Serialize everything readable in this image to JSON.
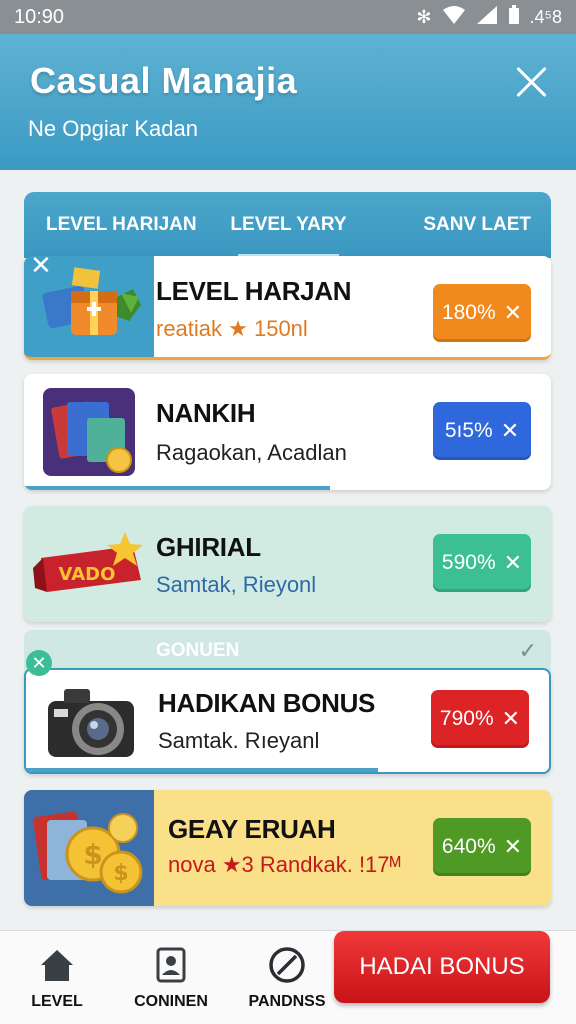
{
  "status_bar": {
    "time": "10:90",
    "battery": ".4⁵8"
  },
  "header": {
    "title": "Casual Manajia",
    "subtitle": "Ne Opgiar Kadan"
  },
  "tabs": [
    {
      "label": "LEVEL HARIJAN",
      "active": false
    },
    {
      "label": "LEVEL YARY",
      "active": true
    },
    {
      "label": "SANV LAET",
      "active": false
    }
  ],
  "cards": [
    {
      "name": "LEVEL HARJAN",
      "sub": "reatiak ★ 150nl",
      "badge": "180%",
      "sub_color": "#e07a22",
      "badge_color": "#f18a1e",
      "icon": "gift-boxes-icon"
    },
    {
      "name": "NANKIH",
      "sub": "Ragaokan, Acadlan",
      "badge": "5ı5%",
      "sub_color": "#222222",
      "badge_color": "#2f67dc",
      "icon": "cards-coins-icon"
    },
    {
      "name": "GHIRIAL",
      "sub": "Samtak, Rieyonl",
      "badge": "590%",
      "sub_color": "#2e6aa6",
      "badge_color": "#3cbf93",
      "icon": "ribbon-star-icon"
    },
    {
      "section_label": "GONUEN",
      "name": "HADIKAN BONUS",
      "sub": "Samtak. Rıeyanl",
      "badge": "790%",
      "sub_color": "#222222",
      "badge_color": "#dc2326",
      "icon": "camera-icon"
    },
    {
      "name": "GEAY ERUAH",
      "sub": "nova ★3 Randkak. !17ᴹ",
      "badge": "640%",
      "sub_color": "#c21b1b",
      "badge_color": "#4e9a24",
      "icon": "gold-coins-icon"
    }
  ],
  "badge_x": "✕",
  "nav": [
    {
      "label": "LEVEL",
      "icon": "home-icon"
    },
    {
      "label": "CONINEN",
      "icon": "profile-card-icon"
    },
    {
      "label": "PANDNSS",
      "icon": "no-entry-icon"
    }
  ],
  "bonus_button": "HADAI BONUS"
}
